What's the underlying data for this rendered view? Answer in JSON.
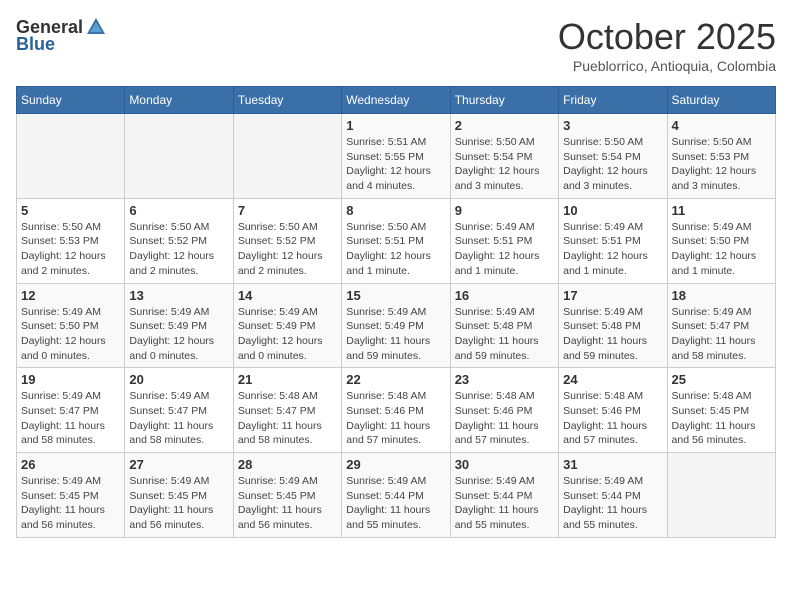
{
  "header": {
    "logo_general": "General",
    "logo_blue": "Blue",
    "month": "October 2025",
    "location": "Pueblorrico, Antioquia, Colombia"
  },
  "weekdays": [
    "Sunday",
    "Monday",
    "Tuesday",
    "Wednesday",
    "Thursday",
    "Friday",
    "Saturday"
  ],
  "weeks": [
    [
      {
        "day": "",
        "info": ""
      },
      {
        "day": "",
        "info": ""
      },
      {
        "day": "",
        "info": ""
      },
      {
        "day": "1",
        "info": "Sunrise: 5:51 AM\nSunset: 5:55 PM\nDaylight: 12 hours\nand 4 minutes."
      },
      {
        "day": "2",
        "info": "Sunrise: 5:50 AM\nSunset: 5:54 PM\nDaylight: 12 hours\nand 3 minutes."
      },
      {
        "day": "3",
        "info": "Sunrise: 5:50 AM\nSunset: 5:54 PM\nDaylight: 12 hours\nand 3 minutes."
      },
      {
        "day": "4",
        "info": "Sunrise: 5:50 AM\nSunset: 5:53 PM\nDaylight: 12 hours\nand 3 minutes."
      }
    ],
    [
      {
        "day": "5",
        "info": "Sunrise: 5:50 AM\nSunset: 5:53 PM\nDaylight: 12 hours\nand 2 minutes."
      },
      {
        "day": "6",
        "info": "Sunrise: 5:50 AM\nSunset: 5:52 PM\nDaylight: 12 hours\nand 2 minutes."
      },
      {
        "day": "7",
        "info": "Sunrise: 5:50 AM\nSunset: 5:52 PM\nDaylight: 12 hours\nand 2 minutes."
      },
      {
        "day": "8",
        "info": "Sunrise: 5:50 AM\nSunset: 5:51 PM\nDaylight: 12 hours\nand 1 minute."
      },
      {
        "day": "9",
        "info": "Sunrise: 5:49 AM\nSunset: 5:51 PM\nDaylight: 12 hours\nand 1 minute."
      },
      {
        "day": "10",
        "info": "Sunrise: 5:49 AM\nSunset: 5:51 PM\nDaylight: 12 hours\nand 1 minute."
      },
      {
        "day": "11",
        "info": "Sunrise: 5:49 AM\nSunset: 5:50 PM\nDaylight: 12 hours\nand 1 minute."
      }
    ],
    [
      {
        "day": "12",
        "info": "Sunrise: 5:49 AM\nSunset: 5:50 PM\nDaylight: 12 hours\nand 0 minutes."
      },
      {
        "day": "13",
        "info": "Sunrise: 5:49 AM\nSunset: 5:49 PM\nDaylight: 12 hours\nand 0 minutes."
      },
      {
        "day": "14",
        "info": "Sunrise: 5:49 AM\nSunset: 5:49 PM\nDaylight: 12 hours\nand 0 minutes."
      },
      {
        "day": "15",
        "info": "Sunrise: 5:49 AM\nSunset: 5:49 PM\nDaylight: 11 hours\nand 59 minutes."
      },
      {
        "day": "16",
        "info": "Sunrise: 5:49 AM\nSunset: 5:48 PM\nDaylight: 11 hours\nand 59 minutes."
      },
      {
        "day": "17",
        "info": "Sunrise: 5:49 AM\nSunset: 5:48 PM\nDaylight: 11 hours\nand 59 minutes."
      },
      {
        "day": "18",
        "info": "Sunrise: 5:49 AM\nSunset: 5:47 PM\nDaylight: 11 hours\nand 58 minutes."
      }
    ],
    [
      {
        "day": "19",
        "info": "Sunrise: 5:49 AM\nSunset: 5:47 PM\nDaylight: 11 hours\nand 58 minutes."
      },
      {
        "day": "20",
        "info": "Sunrise: 5:49 AM\nSunset: 5:47 PM\nDaylight: 11 hours\nand 58 minutes."
      },
      {
        "day": "21",
        "info": "Sunrise: 5:48 AM\nSunset: 5:47 PM\nDaylight: 11 hours\nand 58 minutes."
      },
      {
        "day": "22",
        "info": "Sunrise: 5:48 AM\nSunset: 5:46 PM\nDaylight: 11 hours\nand 57 minutes."
      },
      {
        "day": "23",
        "info": "Sunrise: 5:48 AM\nSunset: 5:46 PM\nDaylight: 11 hours\nand 57 minutes."
      },
      {
        "day": "24",
        "info": "Sunrise: 5:48 AM\nSunset: 5:46 PM\nDaylight: 11 hours\nand 57 minutes."
      },
      {
        "day": "25",
        "info": "Sunrise: 5:48 AM\nSunset: 5:45 PM\nDaylight: 11 hours\nand 56 minutes."
      }
    ],
    [
      {
        "day": "26",
        "info": "Sunrise: 5:49 AM\nSunset: 5:45 PM\nDaylight: 11 hours\nand 56 minutes."
      },
      {
        "day": "27",
        "info": "Sunrise: 5:49 AM\nSunset: 5:45 PM\nDaylight: 11 hours\nand 56 minutes."
      },
      {
        "day": "28",
        "info": "Sunrise: 5:49 AM\nSunset: 5:45 PM\nDaylight: 11 hours\nand 56 minutes."
      },
      {
        "day": "29",
        "info": "Sunrise: 5:49 AM\nSunset: 5:44 PM\nDaylight: 11 hours\nand 55 minutes."
      },
      {
        "day": "30",
        "info": "Sunrise: 5:49 AM\nSunset: 5:44 PM\nDaylight: 11 hours\nand 55 minutes."
      },
      {
        "day": "31",
        "info": "Sunrise: 5:49 AM\nSunset: 5:44 PM\nDaylight: 11 hours\nand 55 minutes."
      },
      {
        "day": "",
        "info": ""
      }
    ]
  ]
}
